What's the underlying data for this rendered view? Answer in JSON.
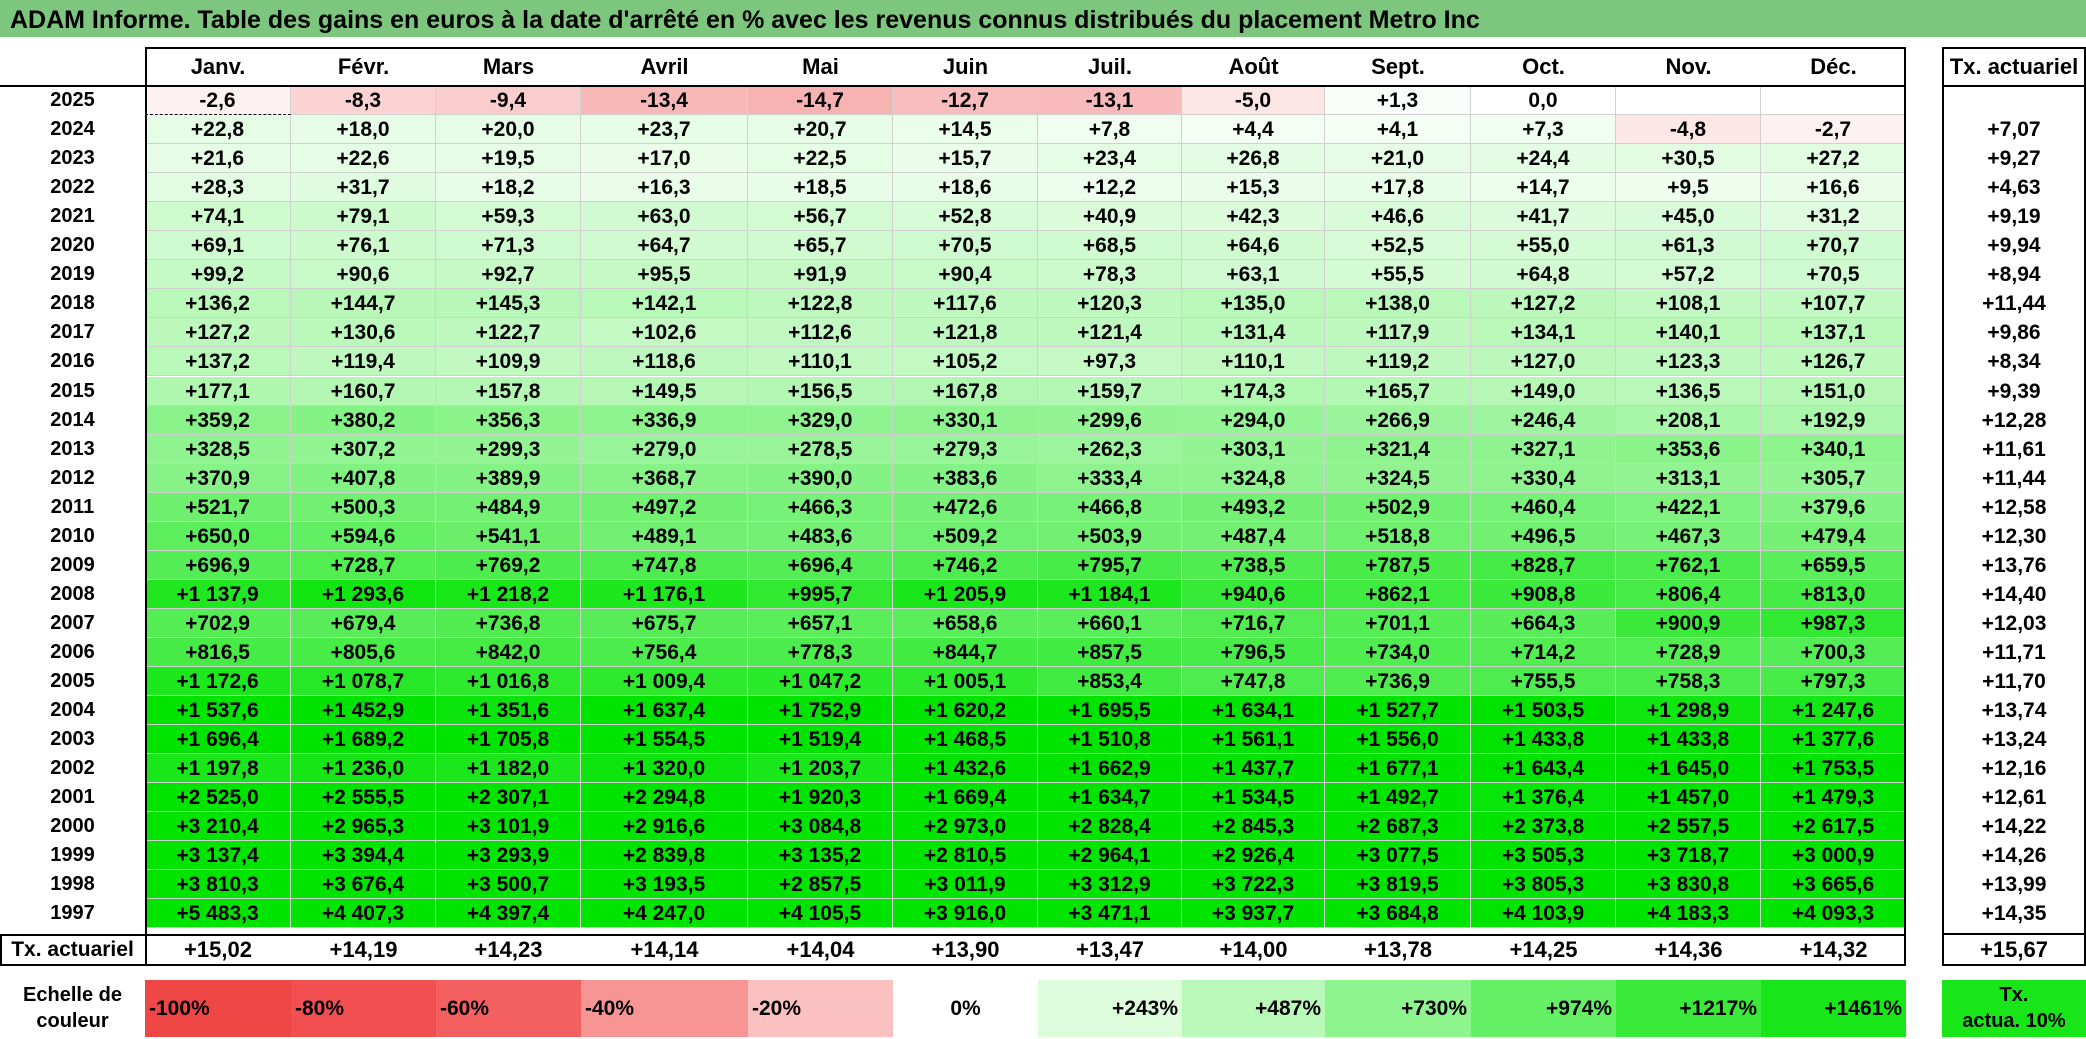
{
  "title": "ADAM Informe. Table des gains en euros à la date d'arrêté en % avec les revenus connus distribués du placement Metro Inc",
  "months": [
    "Janv.",
    "Févr.",
    "Mars",
    "Avril",
    "Mai",
    "Juin",
    "Juil.",
    "Août",
    "Sept.",
    "Oct.",
    "Nov.",
    "Déc."
  ],
  "rate_header": "Tx. actuariel",
  "rows": [
    {
      "year": "2025",
      "values": [
        "-2,6",
        "-8,3",
        "-9,4",
        "-13,4",
        "-14,7",
        "-12,7",
        "-13,1",
        "-5,0",
        "+1,3",
        "0,0",
        "",
        ""
      ],
      "rate": ""
    },
    {
      "year": "2024",
      "values": [
        "+22,8",
        "+18,0",
        "+20,0",
        "+23,7",
        "+20,7",
        "+14,5",
        "+7,8",
        "+4,4",
        "+4,1",
        "+7,3",
        "-4,8",
        "-2,7"
      ],
      "rate": "+7,07"
    },
    {
      "year": "2023",
      "values": [
        "+21,6",
        "+22,6",
        "+19,5",
        "+17,0",
        "+22,5",
        "+15,7",
        "+23,4",
        "+26,8",
        "+21,0",
        "+24,4",
        "+30,5",
        "+27,2"
      ],
      "rate": "+9,27"
    },
    {
      "year": "2022",
      "values": [
        "+28,3",
        "+31,7",
        "+18,2",
        "+16,3",
        "+18,5",
        "+18,6",
        "+12,2",
        "+15,3",
        "+17,8",
        "+14,7",
        "+9,5",
        "+16,6"
      ],
      "rate": "+4,63"
    },
    {
      "year": "2021",
      "values": [
        "+74,1",
        "+79,1",
        "+59,3",
        "+63,0",
        "+56,7",
        "+52,8",
        "+40,9",
        "+42,3",
        "+46,6",
        "+41,7",
        "+45,0",
        "+31,2"
      ],
      "rate": "+9,19"
    },
    {
      "year": "2020",
      "values": [
        "+69,1",
        "+76,1",
        "+71,3",
        "+64,7",
        "+65,7",
        "+70,5",
        "+68,5",
        "+64,6",
        "+52,5",
        "+55,0",
        "+61,3",
        "+70,7"
      ],
      "rate": "+9,94"
    },
    {
      "year": "2019",
      "values": [
        "+99,2",
        "+90,6",
        "+92,7",
        "+95,5",
        "+91,9",
        "+90,4",
        "+78,3",
        "+63,1",
        "+55,5",
        "+64,8",
        "+57,2",
        "+70,5"
      ],
      "rate": "+8,94"
    },
    {
      "year": "2018",
      "values": [
        "+136,2",
        "+144,7",
        "+145,3",
        "+142,1",
        "+122,8",
        "+117,6",
        "+120,3",
        "+135,0",
        "+138,0",
        "+127,2",
        "+108,1",
        "+107,7"
      ],
      "rate": "+11,44"
    },
    {
      "year": "2017",
      "values": [
        "+127,2",
        "+130,6",
        "+122,7",
        "+102,6",
        "+112,6",
        "+121,8",
        "+121,4",
        "+131,4",
        "+117,9",
        "+134,1",
        "+140,1",
        "+137,1"
      ],
      "rate": "+9,86"
    },
    {
      "year": "2016",
      "values": [
        "+137,2",
        "+119,4",
        "+109,9",
        "+118,6",
        "+110,1",
        "+105,2",
        "+97,3",
        "+110,1",
        "+119,2",
        "+127,0",
        "+123,3",
        "+126,7"
      ],
      "rate": "+8,34"
    },
    {
      "year": "2015",
      "values": [
        "+177,1",
        "+160,7",
        "+157,8",
        "+149,5",
        "+156,5",
        "+167,8",
        "+159,7",
        "+174,3",
        "+165,7",
        "+149,0",
        "+136,5",
        "+151,0"
      ],
      "rate": "+9,39"
    },
    {
      "year": "2014",
      "values": [
        "+359,2",
        "+380,2",
        "+356,3",
        "+336,9",
        "+329,0",
        "+330,1",
        "+299,6",
        "+294,0",
        "+266,9",
        "+246,4",
        "+208,1",
        "+192,9"
      ],
      "rate": "+12,28"
    },
    {
      "year": "2013",
      "values": [
        "+328,5",
        "+307,2",
        "+299,3",
        "+279,0",
        "+278,5",
        "+279,3",
        "+262,3",
        "+303,1",
        "+321,4",
        "+327,1",
        "+353,6",
        "+340,1"
      ],
      "rate": "+11,61"
    },
    {
      "year": "2012",
      "values": [
        "+370,9",
        "+407,8",
        "+389,9",
        "+368,7",
        "+390,0",
        "+383,6",
        "+333,4",
        "+324,8",
        "+324,5",
        "+330,4",
        "+313,1",
        "+305,7"
      ],
      "rate": "+11,44"
    },
    {
      "year": "2011",
      "values": [
        "+521,7",
        "+500,3",
        "+484,9",
        "+497,2",
        "+466,3",
        "+472,6",
        "+466,8",
        "+493,2",
        "+502,9",
        "+460,4",
        "+422,1",
        "+379,6"
      ],
      "rate": "+12,58"
    },
    {
      "year": "2010",
      "values": [
        "+650,0",
        "+594,6",
        "+541,1",
        "+489,1",
        "+483,6",
        "+509,2",
        "+503,9",
        "+487,4",
        "+518,8",
        "+496,5",
        "+467,3",
        "+479,4"
      ],
      "rate": "+12,30"
    },
    {
      "year": "2009",
      "values": [
        "+696,9",
        "+728,7",
        "+769,2",
        "+747,8",
        "+696,4",
        "+746,2",
        "+795,7",
        "+738,5",
        "+787,5",
        "+828,7",
        "+762,1",
        "+659,5"
      ],
      "rate": "+13,76"
    },
    {
      "year": "2008",
      "values": [
        "+1 137,9",
        "+1 293,6",
        "+1 218,2",
        "+1 176,1",
        "+995,7",
        "+1 205,9",
        "+1 184,1",
        "+940,6",
        "+862,1",
        "+908,8",
        "+806,4",
        "+813,0"
      ],
      "rate": "+14,40"
    },
    {
      "year": "2007",
      "values": [
        "+702,9",
        "+679,4",
        "+736,8",
        "+675,7",
        "+657,1",
        "+658,6",
        "+660,1",
        "+716,7",
        "+701,1",
        "+664,3",
        "+900,9",
        "+987,3"
      ],
      "rate": "+12,03"
    },
    {
      "year": "2006",
      "values": [
        "+816,5",
        "+805,6",
        "+842,0",
        "+756,4",
        "+778,3",
        "+844,7",
        "+857,5",
        "+796,5",
        "+734,0",
        "+714,2",
        "+728,9",
        "+700,3"
      ],
      "rate": "+11,71"
    },
    {
      "year": "2005",
      "values": [
        "+1 172,6",
        "+1 078,7",
        "+1 016,8",
        "+1 009,4",
        "+1 047,2",
        "+1 005,1",
        "+853,4",
        "+747,8",
        "+736,9",
        "+755,5",
        "+758,3",
        "+797,3"
      ],
      "rate": "+11,70"
    },
    {
      "year": "2004",
      "values": [
        "+1 537,6",
        "+1 452,9",
        "+1 351,6",
        "+1 637,4",
        "+1 752,9",
        "+1 620,2",
        "+1 695,5",
        "+1 634,1",
        "+1 527,7",
        "+1 503,5",
        "+1 298,9",
        "+1 247,6"
      ],
      "rate": "+13,74"
    },
    {
      "year": "2003",
      "values": [
        "+1 696,4",
        "+1 689,2",
        "+1 705,8",
        "+1 554,5",
        "+1 519,4",
        "+1 468,5",
        "+1 510,8",
        "+1 561,1",
        "+1 556,0",
        "+1 433,8",
        "+1 433,8",
        "+1 377,6"
      ],
      "rate": "+13,24"
    },
    {
      "year": "2002",
      "values": [
        "+1 197,8",
        "+1 236,0",
        "+1 182,0",
        "+1 320,0",
        "+1 203,7",
        "+1 432,6",
        "+1 662,9",
        "+1 437,7",
        "+1 677,1",
        "+1 643,4",
        "+1 645,0",
        "+1 753,5"
      ],
      "rate": "+12,16"
    },
    {
      "year": "2001",
      "values": [
        "+2 525,0",
        "+2 555,5",
        "+2 307,1",
        "+2 294,8",
        "+1 920,3",
        "+1 669,4",
        "+1 634,7",
        "+1 534,5",
        "+1 492,7",
        "+1 376,4",
        "+1 457,0",
        "+1 479,3"
      ],
      "rate": "+12,61"
    },
    {
      "year": "2000",
      "values": [
        "+3 210,4",
        "+2 965,3",
        "+3 101,9",
        "+2 916,6",
        "+3 084,8",
        "+2 973,0",
        "+2 828,4",
        "+2 845,3",
        "+2 687,3",
        "+2 373,8",
        "+2 557,5",
        "+2 617,5"
      ],
      "rate": "+14,22"
    },
    {
      "year": "1999",
      "values": [
        "+3 137,4",
        "+3 394,4",
        "+3 293,9",
        "+2 839,8",
        "+3 135,2",
        "+2 810,5",
        "+2 964,1",
        "+2 926,4",
        "+3 077,5",
        "+3 505,3",
        "+3 718,7",
        "+3 000,9"
      ],
      "rate": "+14,26"
    },
    {
      "year": "1998",
      "values": [
        "+3 810,3",
        "+3 676,4",
        "+3 500,7",
        "+3 193,5",
        "+2 857,5",
        "+3 011,9",
        "+3 312,9",
        "+3 722,3",
        "+3 819,5",
        "+3 805,3",
        "+3 830,8",
        "+3 665,6"
      ],
      "rate": "+13,99"
    },
    {
      "year": "1997",
      "values": [
        "+5 483,3",
        "+4 407,3",
        "+4 397,4",
        "+4 247,0",
        "+4 105,5",
        "+3 916,0",
        "+3 471,1",
        "+3 937,7",
        "+3 684,8",
        "+4 103,9",
        "+4 183,3",
        "+4 093,3"
      ],
      "rate": "+14,35"
    }
  ],
  "footer": {
    "label": "Tx. actuariel",
    "values": [
      "+15,02",
      "+14,19",
      "+14,23",
      "+14,14",
      "+14,04",
      "+13,90",
      "+13,47",
      "+14,00",
      "+13,78",
      "+14,25",
      "+14,36",
      "+14,32"
    ],
    "total": "+15,67"
  },
  "scale": {
    "label_line1": "Echelle de",
    "label_line2": "couleur",
    "steps": [
      {
        "text": "-100%",
        "color": "#ef4646",
        "align": "left"
      },
      {
        "text": "-80%",
        "color": "#f25050",
        "align": "left"
      },
      {
        "text": "-60%",
        "color": "#f46060",
        "align": "left"
      },
      {
        "text": "-40%",
        "color": "#f79595",
        "align": "left"
      },
      {
        "text": "-20%",
        "color": "#fbc0c0",
        "align": "left"
      },
      {
        "text": "0%",
        "color": "#ffffff",
        "align": "center"
      },
      {
        "text": "+243%",
        "color": "#dcfcdc",
        "align": "right"
      },
      {
        "text": "+487%",
        "color": "#b8f8b8",
        "align": "right"
      },
      {
        "text": "+730%",
        "color": "#8ef48e",
        "align": "right"
      },
      {
        "text": "+974%",
        "color": "#64ef64",
        "align": "right"
      },
      {
        "text": "+1217%",
        "color": "#3aea3a",
        "align": "right"
      },
      {
        "text": "+1461%",
        "color": "#18e618",
        "align": "right"
      }
    ],
    "legend_line1": "Tx.",
    "legend_line2": "actua. 10%",
    "legend_color": "#19e619"
  },
  "colors": {
    "title_bg": "#7dc67d",
    "negative_max": "#f7b0b0",
    "positive_max": "#00e400"
  }
}
